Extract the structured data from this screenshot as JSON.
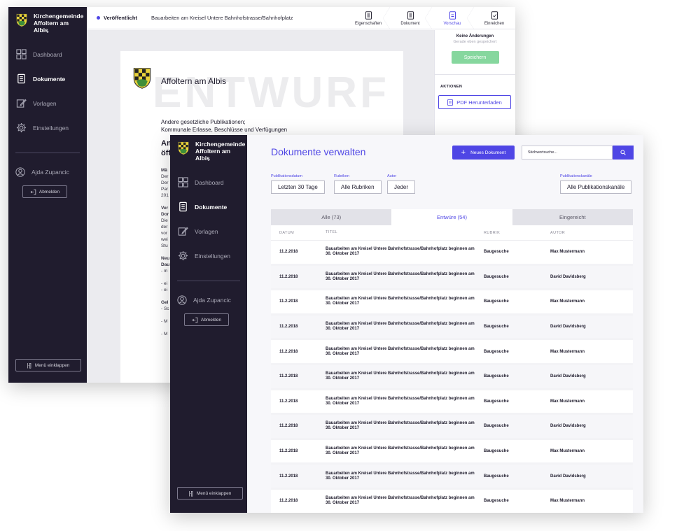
{
  "org": {
    "line1": "Kirchengemeinde",
    "line2": "Affoltern am Albis"
  },
  "nav": {
    "dashboard": "Dashboard",
    "dokumente": "Dokumente",
    "vorlagen": "Vorlagen",
    "einstellungen": "Einstellungen"
  },
  "user": {
    "name": "Ajda Zupancic",
    "logout": "Abmelden"
  },
  "collapse_label": "Menü einklappen",
  "editor": {
    "status": "Veröffentlicht",
    "doc_title": "Bauarbeiten am Kreisel Untere Bahnhofstrasse/Bahnhofplatz",
    "steps": [
      "Eigenschaften",
      "Dokument",
      "Vorschau",
      "Einreichen"
    ],
    "save_state_title": "Keine Änderungen",
    "save_state_sub": "Gerade eben gespeichert",
    "save_label": "Speichern",
    "actions_label": "AKTIONEN",
    "pdf_label": "PDF Herunterladen"
  },
  "preview": {
    "org_name": "Affoltern am Albis",
    "watermark": "ENTWURF",
    "sub1": "Andere gesetzliche Publikationen;",
    "sub2": "Kommunale Erlasse, Beschlüsse und Verfügungen",
    "heading1": "An",
    "heading2": "öff",
    "lines": [
      "Mä",
      "Der",
      "Der",
      "Par",
      "201",
      "",
      "Ver",
      "Dor",
      "Die",
      "der",
      "vor",
      "wei",
      "Stu",
      "",
      "Neu",
      "Dau",
      "- m",
      "",
      "- ei",
      "- ei",
      "",
      "Gel",
      "- Sc",
      "",
      "- M",
      "",
      "- M"
    ]
  },
  "list": {
    "title": "Dokumente verwalten",
    "new_label": "Neues Dokument",
    "search_placeholder": "Stichwortsuche...",
    "filters": [
      {
        "label": "Publikationsdatum",
        "value": "Letzten 30 Tage"
      },
      {
        "label": "Rubriken",
        "value": "Alle Rubriken"
      },
      {
        "label": "Autor",
        "value": "Jeder"
      },
      {
        "label": "Publikationskanäle",
        "value": "Alle Publikationskanäle"
      }
    ],
    "tabs": [
      "Alle (73)",
      "Entwüre (54)",
      "Eingereicht"
    ],
    "columns": [
      "DATUM",
      "TITEL",
      "RUBRIK",
      "AUTOR"
    ],
    "rows": [
      {
        "date": "11.2.2018",
        "title": "Bauarbeiten am Kreisel Untere Bahnhofstrasse/Bahnhofplatz beginnen am 30. Oktober 2017",
        "rubrik": "Baugesuche",
        "author": "Max Mustermann"
      },
      {
        "date": "11.2.2018",
        "title": "Bauarbeiten am Kreisel Untere Bahnhofstrasse/Bahnhofplatz beginnen am 30. Oktober 2017",
        "rubrik": "Baugesuche",
        "author": "David Davidsberg"
      },
      {
        "date": "11.2.2018",
        "title": "Bauarbeiten am Kreisel Untere Bahnhofstrasse/Bahnhofplatz beginnen am 30. Oktober 2017",
        "rubrik": "Baugesuche",
        "author": "Max Mustermann"
      },
      {
        "date": "11.2.2018",
        "title": "Bauarbeiten am Kreisel Untere Bahnhofstrasse/Bahnhofplatz beginnen am 30. Oktober 2017",
        "rubrik": "Baugesuche",
        "author": "David Davidsberg"
      },
      {
        "date": "11.2.2018",
        "title": "Bauarbeiten am Kreisel Untere Bahnhofstrasse/Bahnhofplatz beginnen am 30. Oktober 2017",
        "rubrik": "Baugesuche",
        "author": "Max Mustermann"
      },
      {
        "date": "11.2.2018",
        "title": "Bauarbeiten am Kreisel Untere Bahnhofstrasse/Bahnhofplatz beginnen am 30. Oktober 2017",
        "rubrik": "Baugesuche",
        "author": "David Davidsberg"
      },
      {
        "date": "11.2.2018",
        "title": "Bauarbeiten am Kreisel Untere Bahnhofstrasse/Bahnhofplatz beginnen am 30. Oktober 2017",
        "rubrik": "Baugesuche",
        "author": "Max Mustermann"
      },
      {
        "date": "11.2.2018",
        "title": "Bauarbeiten am Kreisel Untere Bahnhofstrasse/Bahnhofplatz beginnen am 30. Oktober 2017",
        "rubrik": "Baugesuche",
        "author": "David Davidsberg"
      },
      {
        "date": "11.2.2018",
        "title": "Bauarbeiten am Kreisel Untere Bahnhofstrasse/Bahnhofplatz beginnen am 30. Oktober 2017",
        "rubrik": "Baugesuche",
        "author": "Max Mustermann"
      },
      {
        "date": "11.2.2018",
        "title": "Bauarbeiten am Kreisel Untere Bahnhofstrasse/Bahnhofplatz beginnen am 30. Oktober 2017",
        "rubrik": "Baugesuche",
        "author": "David Davidsberg"
      },
      {
        "date": "11.2.2018",
        "title": "Bauarbeiten am Kreisel Untere Bahnhofstrasse/Bahnhofplatz beginnen am 30. Oktober 2017",
        "rubrik": "Baugesuche",
        "author": "Max Mustermann"
      }
    ]
  },
  "colors": {
    "accent": "#4f46e5",
    "sidebar": "#201c2e",
    "save": "#86d79e"
  }
}
